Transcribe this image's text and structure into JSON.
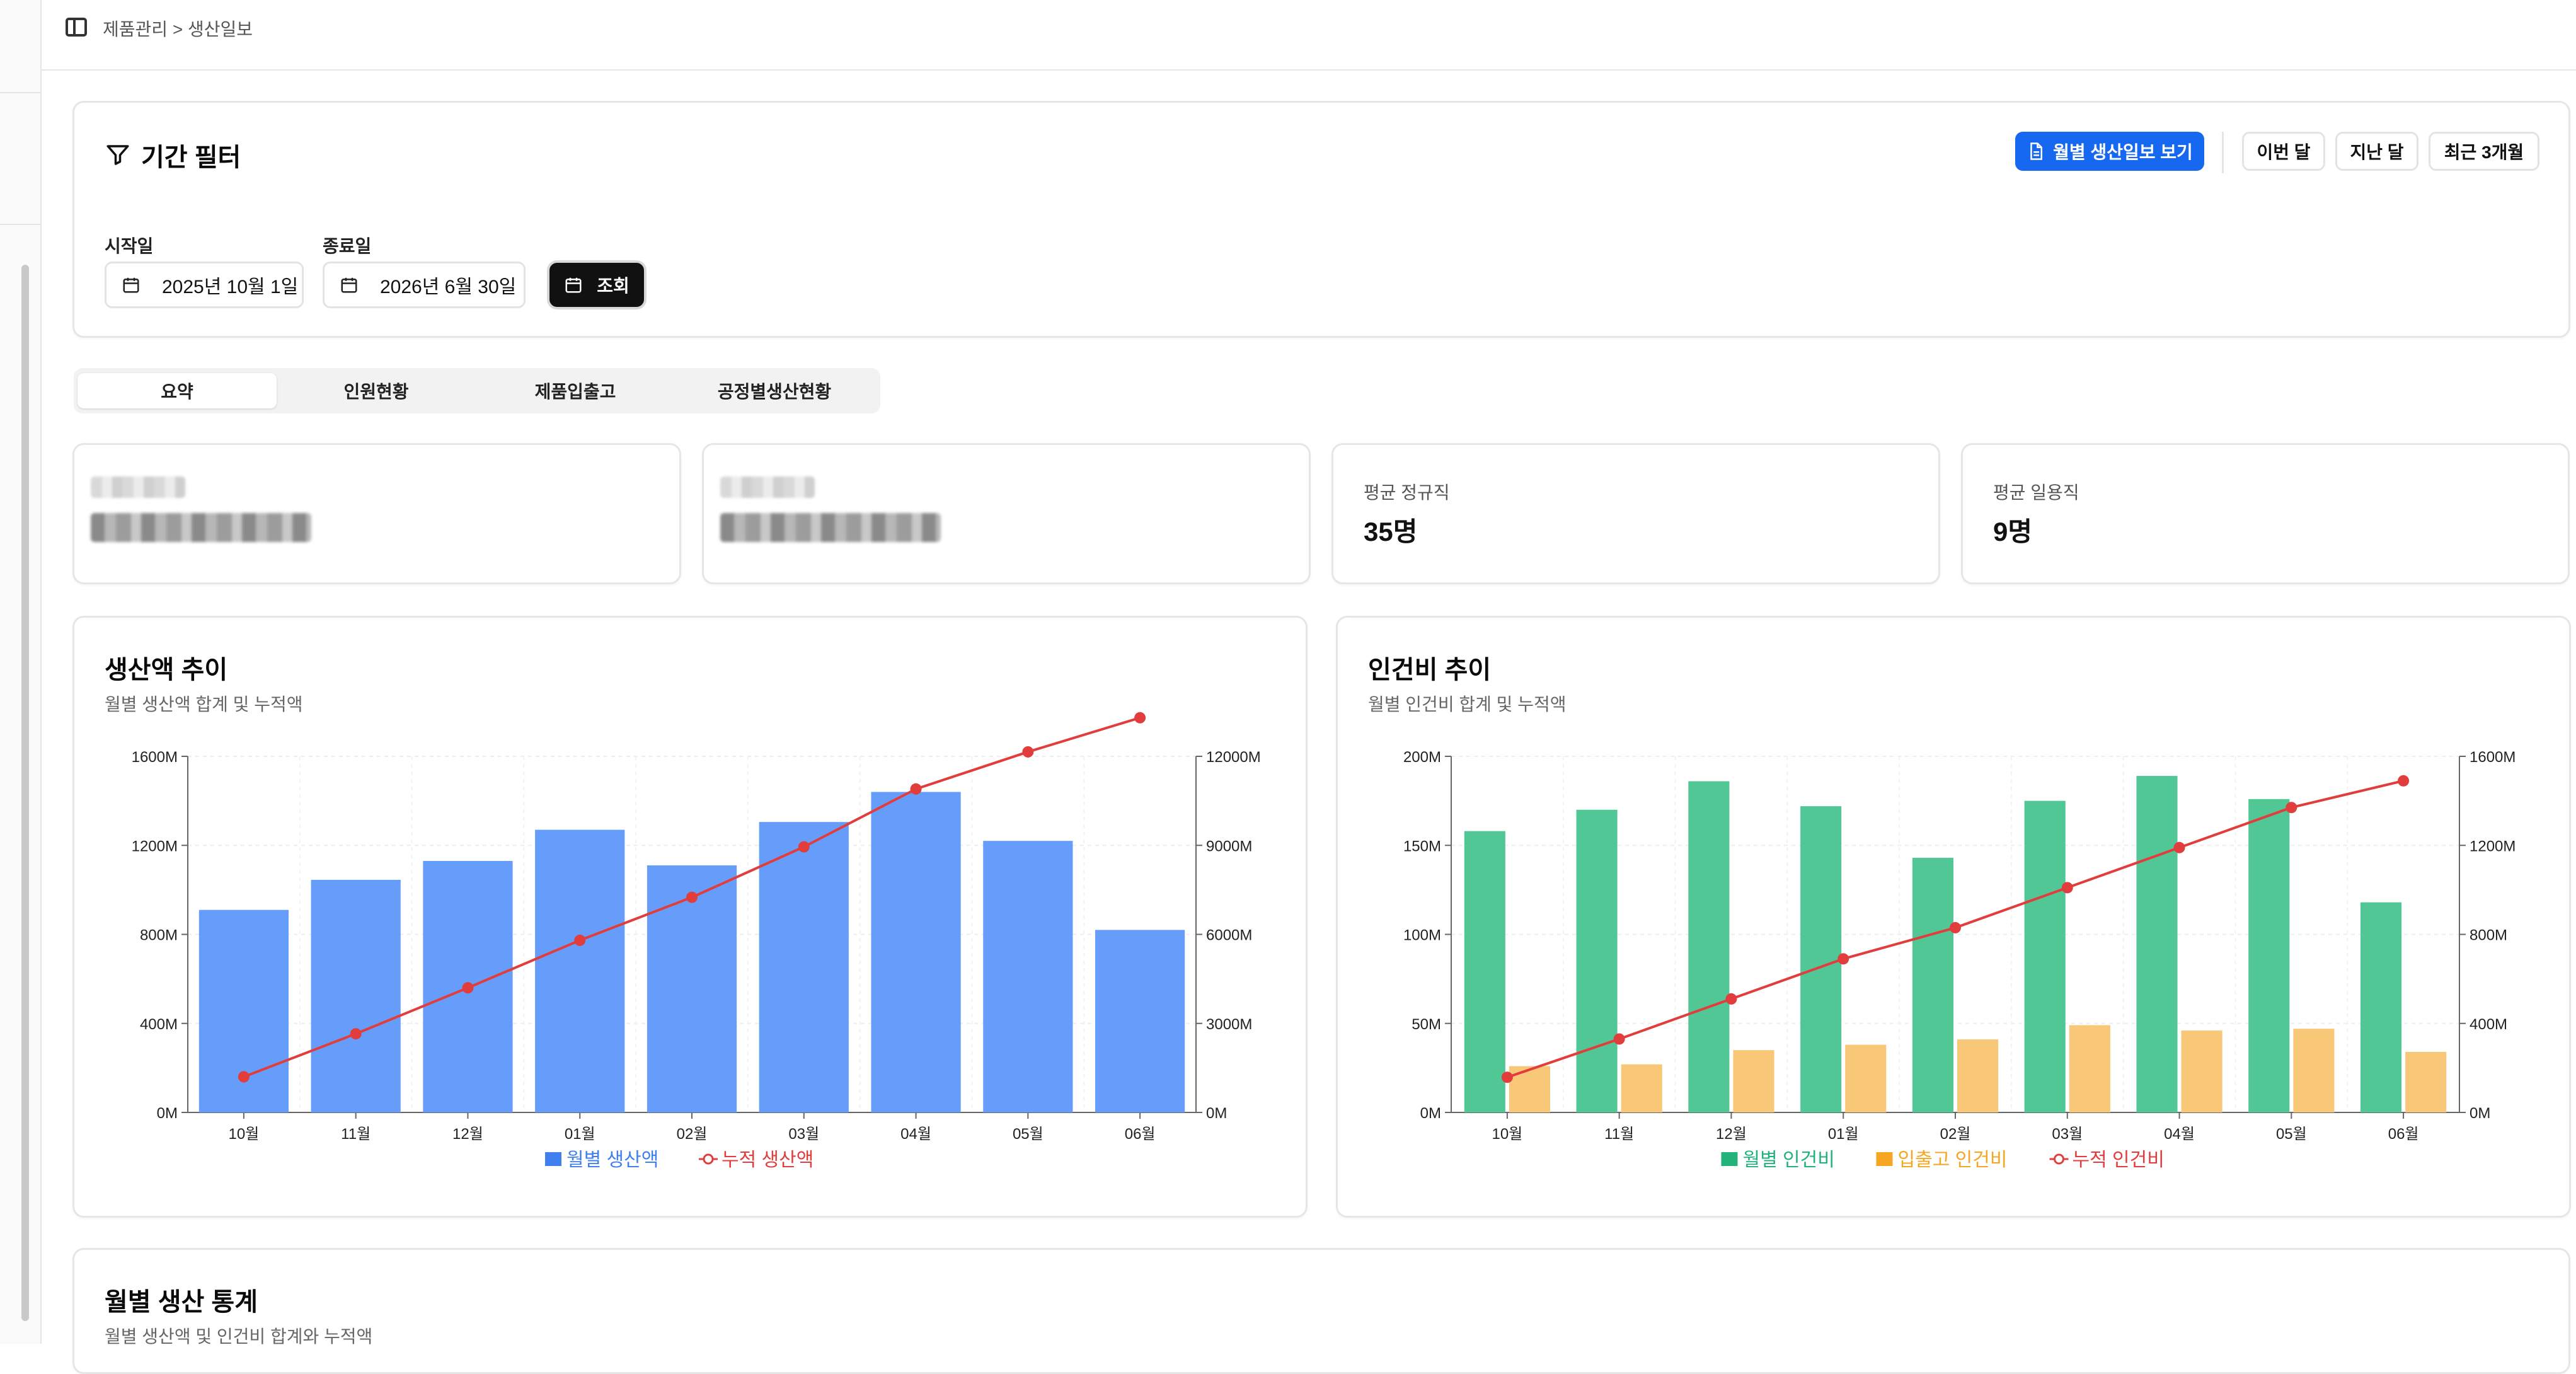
{
  "breadcrumb": "제품관리 > 생산일보",
  "filter": {
    "title": "기간 필터",
    "monthly_button": "월별 생산일보 보기",
    "presets": [
      "이번 달",
      "지난 달",
      "최근 3개월"
    ],
    "start_label": "시작일",
    "start_value": "2025년 10월 1일",
    "end_label": "종료일",
    "end_value": "2026년 6월 30일",
    "query_button": "조회"
  },
  "tabs": [
    "요약",
    "인원현황",
    "제품입출고",
    "공정별생산현황"
  ],
  "stats": [
    {
      "label": "평균 정규직",
      "value": "35명"
    },
    {
      "label": "평균 일용직",
      "value": "9명"
    }
  ],
  "colors": {
    "primary": "#1668f0",
    "bar_blue": "#669dfa",
    "line_red": "#e23d3d",
    "bar_green": "#52c796",
    "bar_orange": "#f9c778"
  },
  "charts": {
    "production": {
      "title": "생산액 추이",
      "subtitle": "월별 생산액 합계 및 누적액"
    },
    "labor": {
      "title": "인건비 추이",
      "subtitle": "월별 인건비 합계 및 누적액"
    }
  },
  "bottom": {
    "title": "월별 생산 통계",
    "subtitle": "월별 생산액 및 인건비 합계와 누적액"
  },
  "chart_data": [
    {
      "type": "bar",
      "title": "생산액 추이",
      "categories": [
        "10월",
        "11월",
        "12월",
        "01월",
        "02월",
        "03월",
        "04월",
        "05월",
        "06월"
      ],
      "series": [
        {
          "name": "월별 생산액",
          "type": "bar",
          "axis": "left",
          "values": [
            910,
            1045,
            1130,
            1270,
            1110,
            1305,
            1440,
            1220,
            820
          ]
        },
        {
          "name": "누적 생산액",
          "type": "line",
          "axis": "right",
          "values": [
            1200,
            2650,
            4200,
            5800,
            7250,
            8950,
            10900,
            12150,
            13300
          ]
        }
      ],
      "y_left": {
        "range": [
          0,
          1600
        ],
        "ticks": [
          "0M",
          "400M",
          "800M",
          "1200M",
          "1600M"
        ]
      },
      "y_right": {
        "range": [
          0,
          12000
        ],
        "ticks": [
          "0M",
          "3000M",
          "6000M",
          "9000M",
          "12000M"
        ]
      },
      "legend": "bottom"
    },
    {
      "type": "bar",
      "title": "인건비 추이",
      "categories": [
        "10월",
        "11월",
        "12월",
        "01월",
        "02월",
        "03월",
        "04월",
        "05월",
        "06월"
      ],
      "series": [
        {
          "name": "월별 인건비",
          "type": "bar",
          "axis": "left",
          "values": [
            158,
            170,
            186,
            172,
            143,
            175,
            189,
            176,
            118
          ]
        },
        {
          "name": "입출고 인건비",
          "type": "bar",
          "axis": "left",
          "values": [
            26,
            27,
            35,
            38,
            41,
            49,
            46,
            47,
            34
          ]
        },
        {
          "name": "누적 인건비",
          "type": "line",
          "axis": "right",
          "values": [
            158,
            330,
            510,
            690,
            830,
            1010,
            1190,
            1370,
            1490
          ]
        }
      ],
      "y_left": {
        "range": [
          0,
          200
        ],
        "ticks": [
          "0M",
          "50M",
          "100M",
          "150M",
          "200M"
        ]
      },
      "y_right": {
        "range": [
          0,
          1600
        ],
        "ticks": [
          "0M",
          "400M",
          "800M",
          "1200M",
          "1600M"
        ]
      },
      "legend": "bottom"
    }
  ]
}
